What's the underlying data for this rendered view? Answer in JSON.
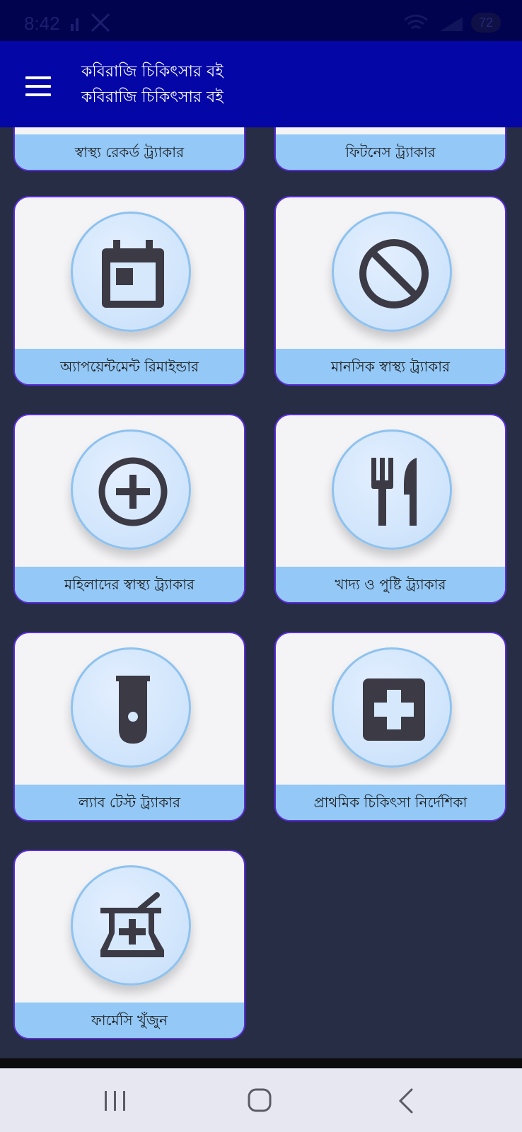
{
  "status_bar": {
    "time": "8:42",
    "battery": "72",
    "icons": [
      "signal-icon",
      "silent-icon",
      "wifi-icon",
      "battery-icon"
    ]
  },
  "app_bar": {
    "title_line1": "কবিরাজি চিকিৎসার বই",
    "title_line2": "কবিরাজি চিকিৎসার বই",
    "menu_icon": "hamburger-menu-icon"
  },
  "cards": [
    {
      "label": "স্বাস্থ্য রেকর্ড ট্র্যাকার",
      "icon": "health-record-icon"
    },
    {
      "label": "ফিটনেস ট্র্যাকার",
      "icon": "fitness-icon"
    },
    {
      "label": "অ্যাপয়েন্টমেন্ট রিমাইন্ডার",
      "icon": "calendar-icon"
    },
    {
      "label": "মানসিক স্বাস্থ্য ট্র্যাকার",
      "icon": "block-icon"
    },
    {
      "label": "মহিলাদের স্বাস্থ্য ট্র্যাকার",
      "icon": "add-circle-icon"
    },
    {
      "label": "খাদ্য ও পুষ্টি ট্র্যাকার",
      "icon": "restaurant-icon"
    },
    {
      "label": "ল্যাব টেস্ট ট্র্যাকার",
      "icon": "test-tube-icon"
    },
    {
      "label": "প্রাথমিক চিকিৎসা নির্দেশিকা",
      "icon": "first-aid-icon"
    },
    {
      "label": "ফার্মেসি খুঁজুন",
      "icon": "pharmacy-mortar-icon"
    }
  ],
  "nav_bar": {
    "recents": "recents-icon",
    "home": "home-icon",
    "back": "back-icon"
  },
  "colors": {
    "app_bar": "#0406a6",
    "status_bar": "#02034f",
    "background": "#262d44",
    "card_label_bg": "#93c8f7",
    "card_border": "#5b2ee0",
    "icon_fill": "#3b3a45"
  }
}
